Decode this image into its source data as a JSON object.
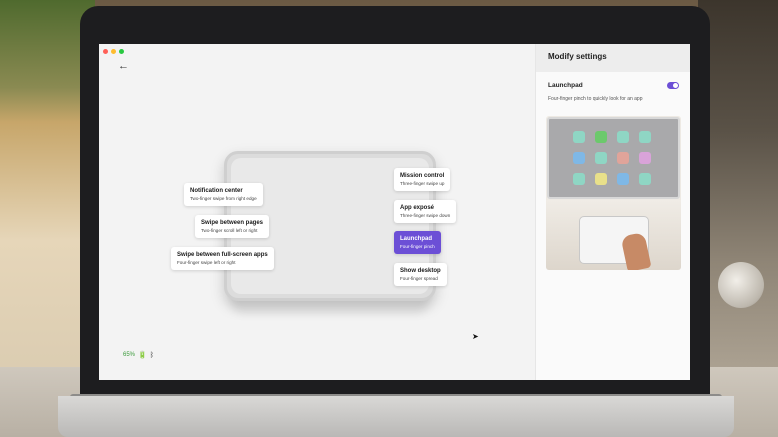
{
  "window": {
    "traffic_colors": [
      "#ff5f57",
      "#febc2e",
      "#28c840"
    ],
    "back_icon": "←"
  },
  "gestures": {
    "left": [
      {
        "title": "Notification center",
        "subtitle": "Two-finger swipe from right edge"
      },
      {
        "title": "Swipe between pages",
        "subtitle": "Two-finger scroll left or right"
      },
      {
        "title": "Swipe between full-screen apps",
        "subtitle": "Four-finger swipe left or right"
      }
    ],
    "right": [
      {
        "title": "Mission control",
        "subtitle": "Three-finger swipe up"
      },
      {
        "title": "App exposé",
        "subtitle": "Three-finger swipe down"
      },
      {
        "title": "Launchpad",
        "subtitle": "Four-finger pinch"
      },
      {
        "title": "Show desktop",
        "subtitle": "Four-finger spread"
      }
    ],
    "active": "Launchpad"
  },
  "status": {
    "battery": "65%",
    "battery_icon": "🔋",
    "bluetooth_icon": "ᛒ"
  },
  "panel": {
    "title": "Modify settings",
    "setting_name": "Launchpad",
    "setting_enabled": true,
    "setting_desc": "Four-finger pinch to quickly look for an app"
  },
  "preview_app_colors": [
    "#8fd6c4",
    "#6cc96c",
    "#8fd6c4",
    "#8fd6c4",
    "#7fb8e6",
    "#8fd6c4",
    "#e0a49a",
    "#d9a3d9",
    "#8fd6c4",
    "#e8e08a",
    "#7fb8e6",
    "#8fd6c4"
  ],
  "accent_color": "#6c4fd6"
}
